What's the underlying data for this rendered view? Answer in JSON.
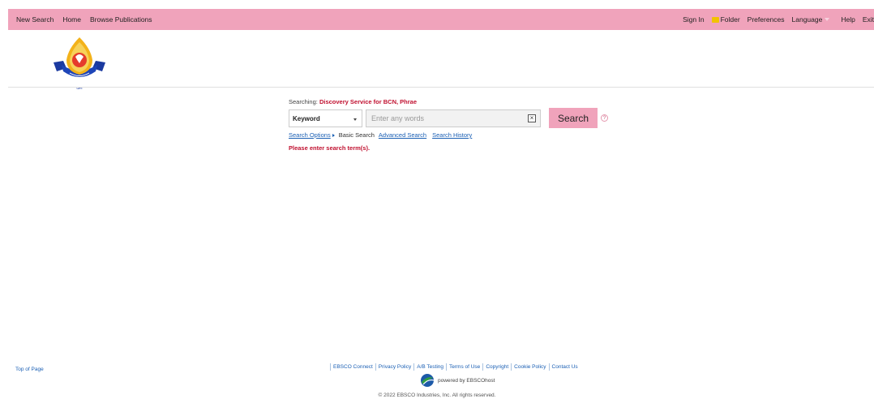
{
  "top_nav": {
    "left": [
      "New Search",
      "Home",
      "Browse Publications"
    ],
    "sign_in": "Sign In",
    "folder": "Folder",
    "preferences": "Preferences",
    "language": "Language",
    "help": "Help",
    "exit": "Exit"
  },
  "search": {
    "searching_label": "Searching:",
    "database": "Discovery Service for BCN, Phrae",
    "field_selected": "Keyword",
    "placeholder": "Enter any words",
    "search_button": "Search",
    "help_glyph": "?"
  },
  "links": {
    "search_options": "Search Options",
    "basic_search": "Basic Search",
    "advanced_search": "Advanced Search",
    "search_history": "Search History"
  },
  "error_message": "Please enter search term(s).",
  "footer": {
    "top_of_page": "Top of Page",
    "links": [
      "EBSCO Connect",
      "Privacy Policy",
      "A/B Testing",
      "Terms of Use",
      "Copyright",
      "Cookie Policy",
      "Contact Us"
    ],
    "powered_by": "powered by EBSCOhost",
    "copyright": "© 2022 EBSCO Industries, Inc. All rights reserved."
  },
  "colors": {
    "topbar": "#f0a3bb",
    "accent_red": "#c0102f",
    "link_blue": "#1a5fb4"
  }
}
